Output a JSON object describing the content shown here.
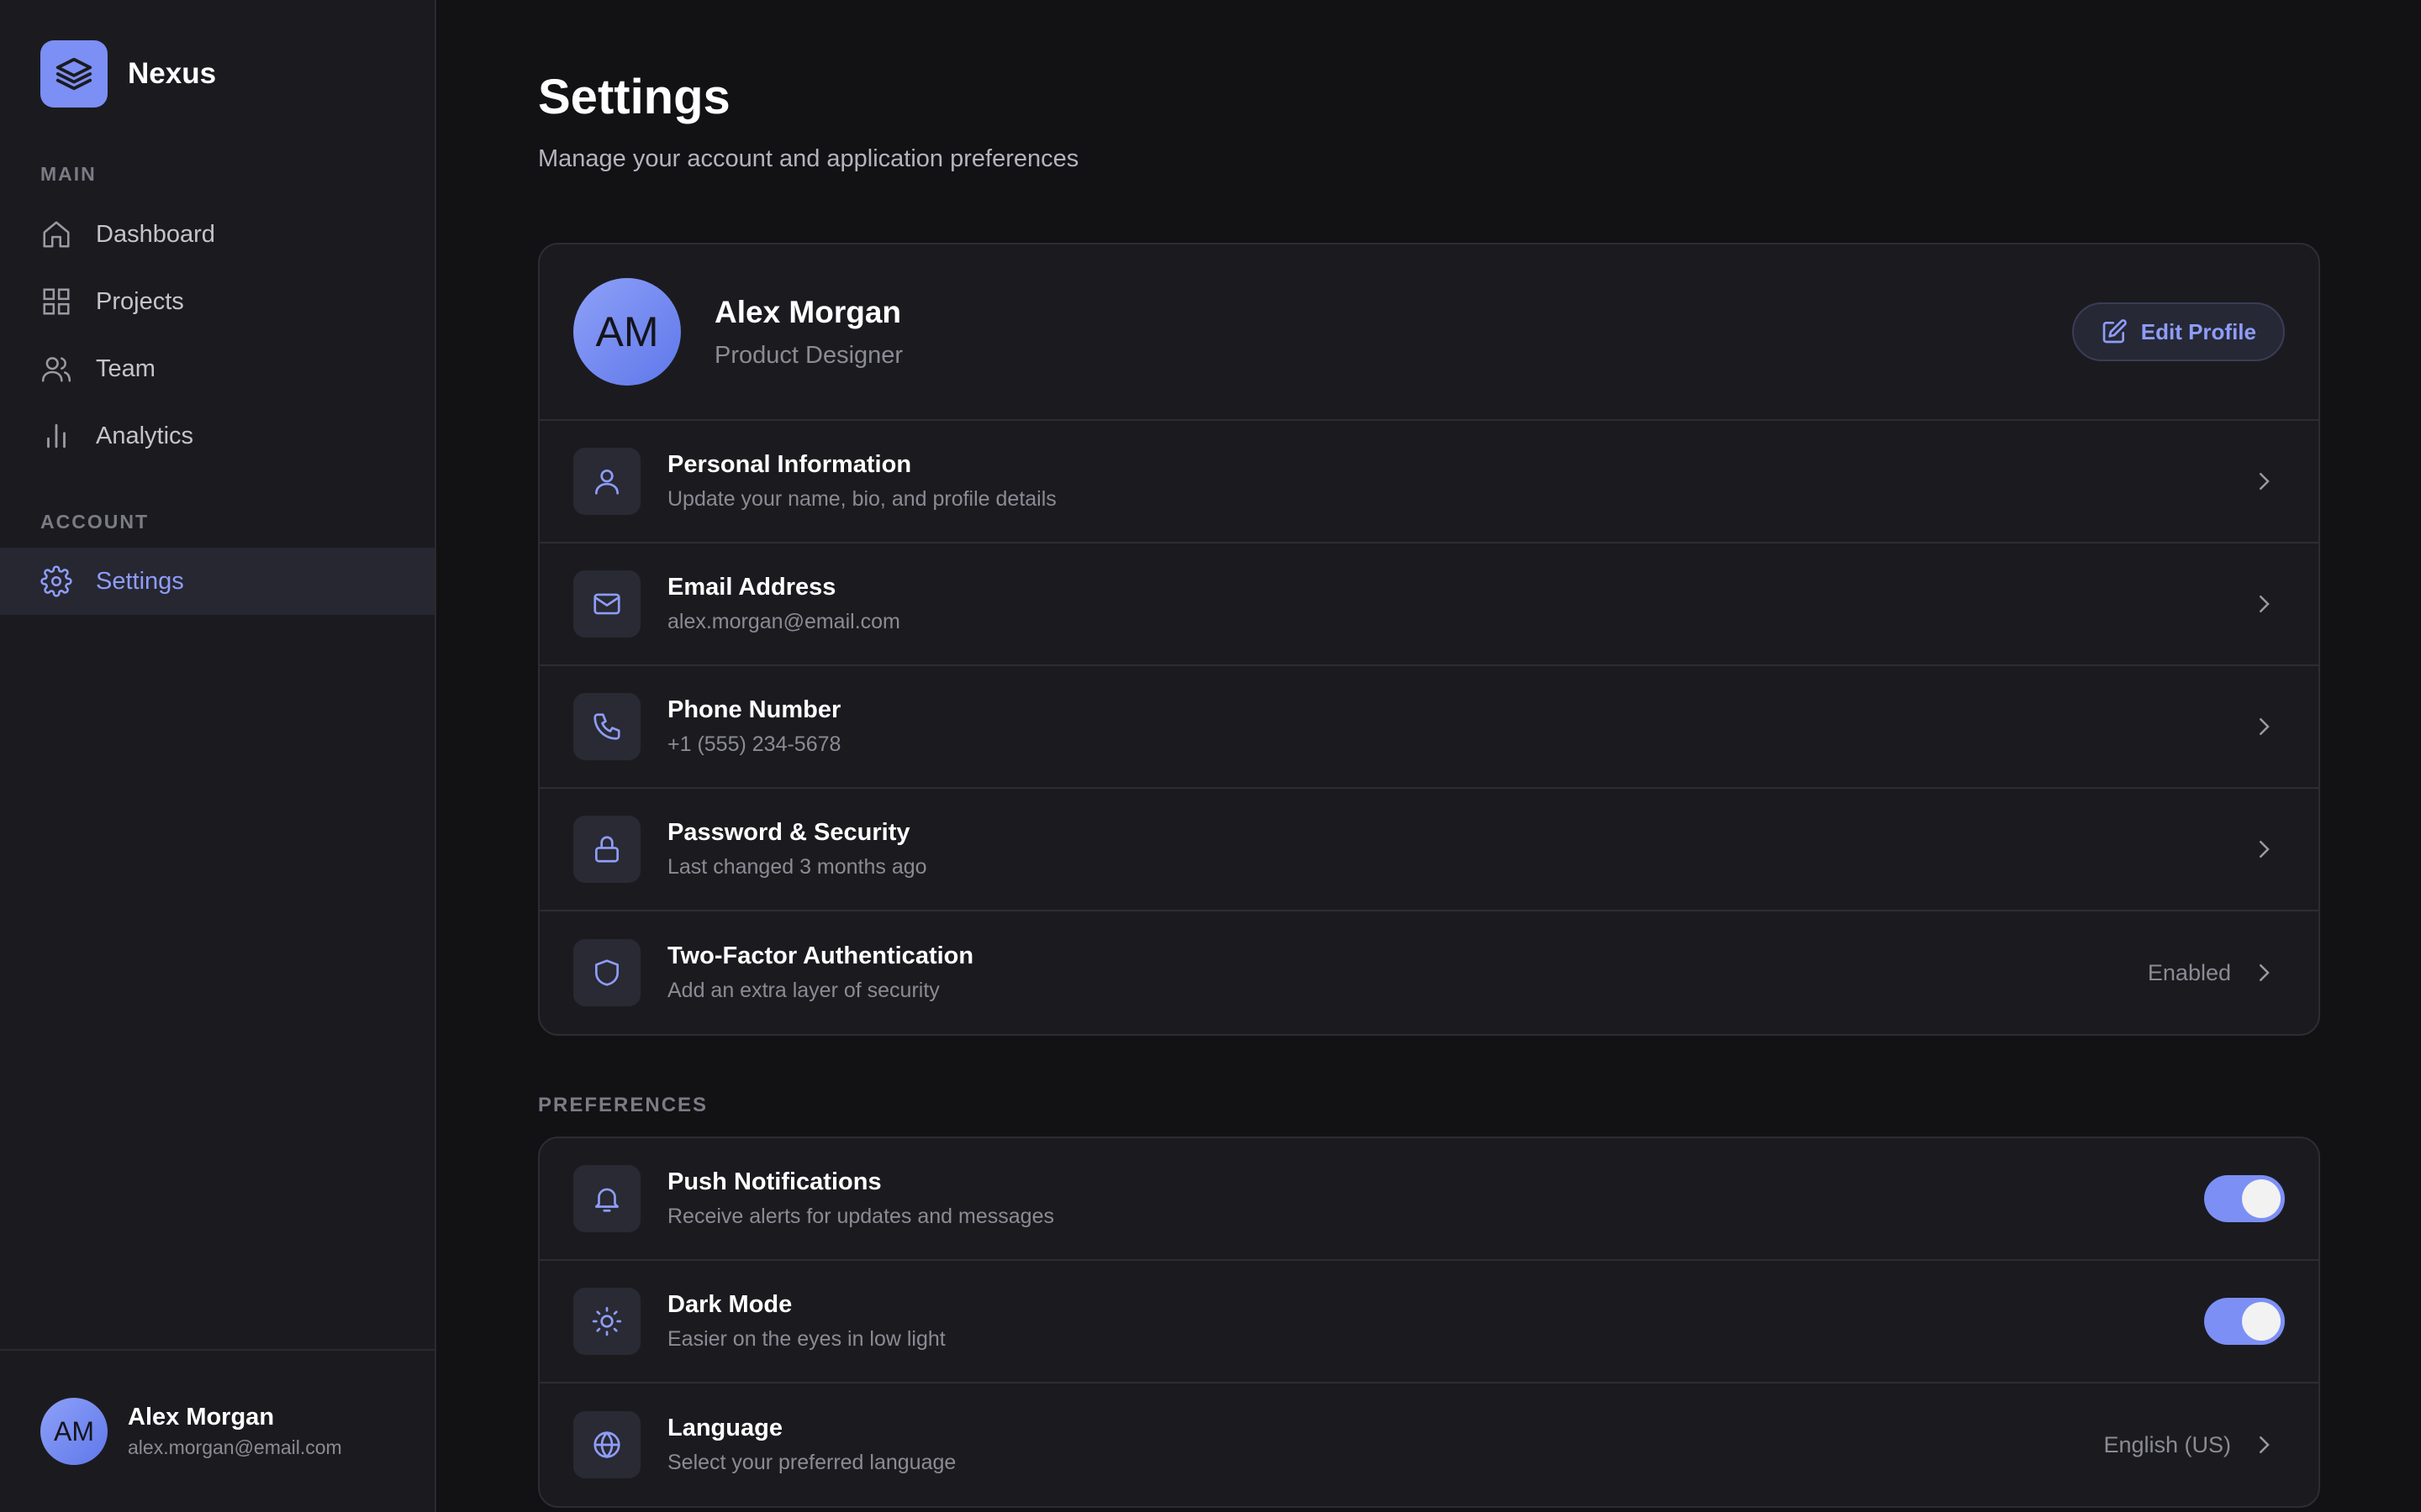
{
  "brand": {
    "name": "Nexus"
  },
  "sidebar": {
    "section_main": "MAIN",
    "section_account": "ACCOUNT",
    "items": [
      {
        "label": "Dashboard",
        "icon": "home-icon"
      },
      {
        "label": "Projects",
        "icon": "grid-icon"
      },
      {
        "label": "Team",
        "icon": "users-icon"
      },
      {
        "label": "Analytics",
        "icon": "bar-chart-icon"
      },
      {
        "label": "Settings",
        "icon": "gear-icon",
        "active": true
      }
    ],
    "user": {
      "initials": "AM",
      "name": "Alex Morgan",
      "email": "alex.morgan@email.com"
    }
  },
  "page": {
    "title": "Settings",
    "subtitle": "Manage your account and application preferences"
  },
  "profile": {
    "initials": "AM",
    "name": "Alex Morgan",
    "role": "Product Designer",
    "edit_label": "Edit Profile"
  },
  "account_rows": [
    {
      "title": "Personal Information",
      "subtitle": "Update your name, bio, and profile details",
      "icon": "user-icon"
    },
    {
      "title": "Email Address",
      "subtitle": "alex.morgan@email.com",
      "icon": "mail-icon"
    },
    {
      "title": "Phone Number",
      "subtitle": "+1 (555) 234-5678",
      "icon": "phone-icon"
    },
    {
      "title": "Password & Security",
      "subtitle": "Last changed 3 months ago",
      "icon": "lock-icon"
    },
    {
      "title": "Two-Factor Authentication",
      "subtitle": "Add an extra layer of security",
      "icon": "shield-icon",
      "value": "Enabled"
    }
  ],
  "preferences": {
    "label": "PREFERENCES",
    "rows": [
      {
        "title": "Push Notifications",
        "subtitle": "Receive alerts for updates and messages",
        "icon": "bell-icon",
        "toggle_on": true
      },
      {
        "title": "Dark Mode",
        "subtitle": "Easier on the eyes in low light",
        "icon": "sun-icon",
        "toggle_on": true
      },
      {
        "title": "Language",
        "subtitle": "Select your preferred language",
        "icon": "globe-icon",
        "value": "English (US)"
      }
    ]
  },
  "colors": {
    "accent": "#7c8ff5",
    "accent_text": "#8e9df8",
    "background": "#121214",
    "surface": "#1b1b1f",
    "border": "#2c2c33"
  }
}
